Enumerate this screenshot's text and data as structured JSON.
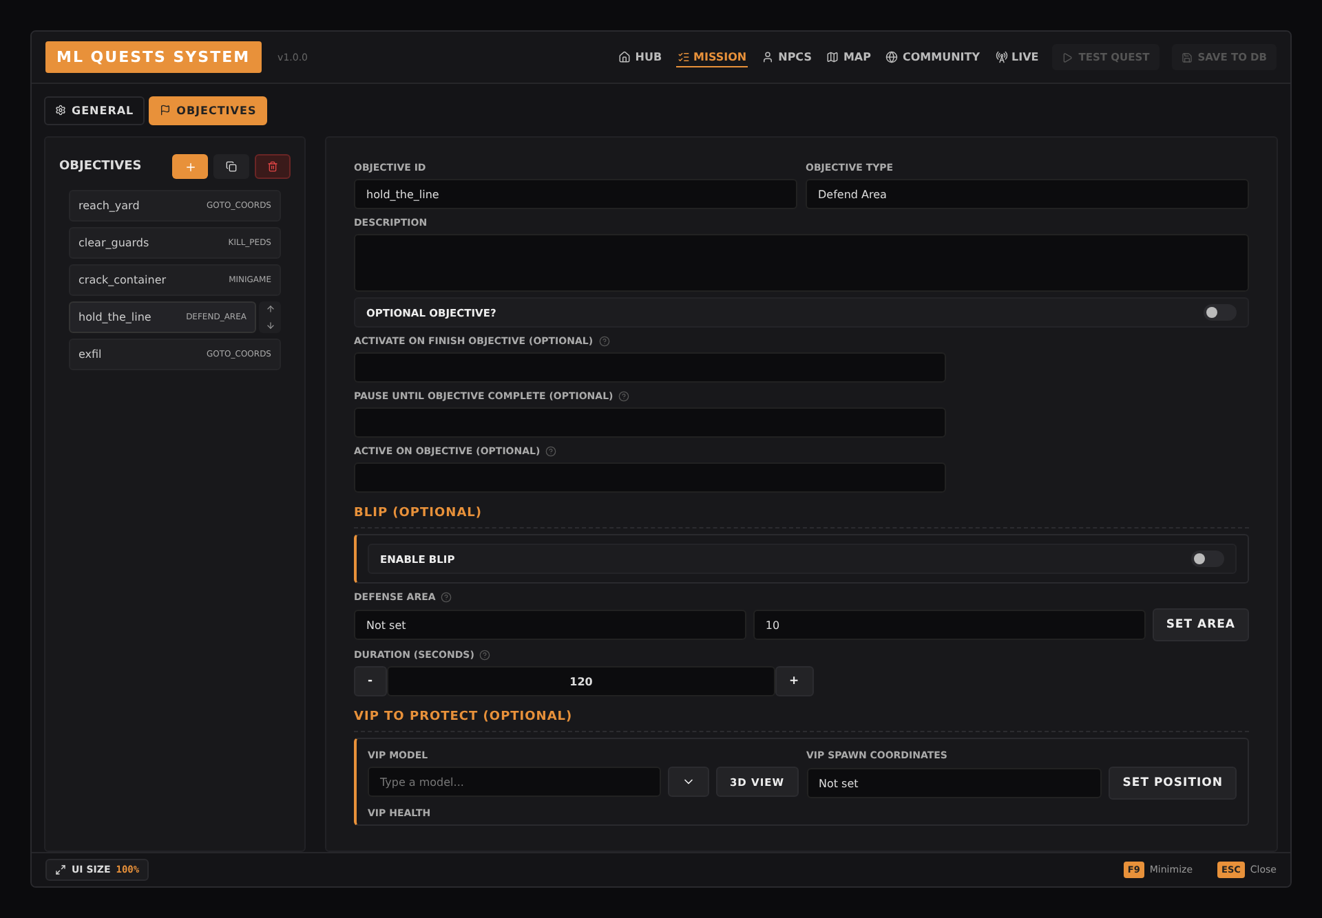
{
  "header": {
    "title": "ML QUESTS SYSTEM",
    "version": "v1.0.0",
    "nav": [
      {
        "label": "HUB",
        "selected": false
      },
      {
        "label": "MISSION",
        "selected": true
      },
      {
        "label": "NPCS",
        "selected": false
      },
      {
        "label": "MAP",
        "selected": false
      },
      {
        "label": "COMMUNITY",
        "selected": false
      },
      {
        "label": "LIVE",
        "selected": false
      }
    ],
    "actions": [
      {
        "label": "TEST QUEST",
        "disabled": true
      },
      {
        "label": "SAVE TO DB",
        "disabled": true
      }
    ]
  },
  "tabs": [
    {
      "label": "GENERAL",
      "selected": false
    },
    {
      "label": "OBJECTIVES",
      "selected": true
    }
  ],
  "objectives": {
    "title": "OBJECTIVES",
    "items": [
      {
        "name": "reach_yard",
        "type": "GOTO_COORDS",
        "selected": false
      },
      {
        "name": "clear_guards",
        "type": "KILL_PEDS",
        "selected": false
      },
      {
        "name": "crack_container",
        "type": "MINIGAME",
        "selected": false
      },
      {
        "name": "hold_the_line",
        "type": "DEFEND_AREA",
        "selected": true
      },
      {
        "name": "exfil",
        "type": "GOTO_COORDS",
        "selected": false
      }
    ]
  },
  "form": {
    "objective_id": {
      "label": "OBJECTIVE ID",
      "value": "hold_the_line"
    },
    "objective_type": {
      "label": "OBJECTIVE TYPE",
      "value": "Defend Area"
    },
    "description": {
      "label": "DESCRIPTION"
    },
    "optional": {
      "label": "OPTIONAL OBJECTIVE?",
      "on": false
    },
    "links": [
      {
        "label": "ACTIVATE ON FINISH OBJECTIVE (OPTIONAL)"
      },
      {
        "label": "PAUSE UNTIL OBJECTIVE COMPLETE (OPTIONAL)"
      },
      {
        "label": "ACTIVE ON OBJECTIVE (OPTIONAL)"
      }
    ]
  },
  "blip": {
    "title": "BLIP (OPTIONAL)",
    "toggle_label": "ENABLE BLIP",
    "on": false
  },
  "defense": {
    "label": "DEFENSE AREA",
    "coords": "Not set",
    "radius": "10",
    "button": "SET AREA",
    "duration_label": "DURATION (SECONDS)",
    "minus": "-",
    "duration": "120",
    "plus": "+"
  },
  "vip": {
    "title": "VIP TO PROTECT (OPTIONAL)",
    "model_label": "VIP MODEL",
    "model_placeholder": "Type a model...",
    "view_button": "3D VIEW",
    "spawn_label": "VIP SPAWN COORDINATES",
    "spawn_value": "Not set",
    "spawn_button": "SET POSITION",
    "health_label": "VIP HEALTH"
  },
  "footer": {
    "ui_size_label": "UI SIZE",
    "ui_size": "100%",
    "shortcuts": [
      {
        "key": "F9",
        "label": "Minimize"
      },
      {
        "key": "ESC",
        "label": "Close"
      }
    ]
  }
}
